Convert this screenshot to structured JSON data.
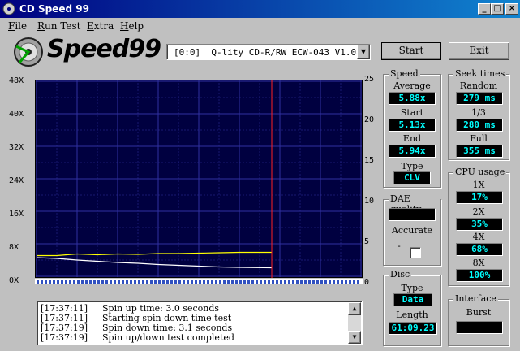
{
  "window": {
    "title": "CD Speed 99",
    "minimize": "_",
    "maximize": "□",
    "close": "×"
  },
  "menu": [
    "File",
    "Run Test",
    "Extra",
    "Help"
  ],
  "logo": {
    "text": "Speed99"
  },
  "drive": {
    "selected": "[0:0]  Q-lity CD-R/RW ECW-043 V1.0a",
    "arrow": "▼"
  },
  "buttons": {
    "start": "Start",
    "exit": "Exit"
  },
  "speed": {
    "title": "Speed",
    "average_label": "Average",
    "average": "5.88x",
    "start_label": "Start",
    "start": "5.13x",
    "end_label": "End",
    "end": "5.94x",
    "type_label": "Type",
    "type": "CLV"
  },
  "seek": {
    "title": "Seek times",
    "random_label": "Random",
    "random": "279 ms",
    "third_label": "1/3",
    "third": "280 ms",
    "full_label": "Full",
    "full": "355 ms"
  },
  "dae": {
    "title": "DAE quality",
    "value": "",
    "accurate_label": "Accurate",
    "accurate_dash": "-"
  },
  "cpu": {
    "title": "CPU usage",
    "items": [
      {
        "label": "1X",
        "value": "17%"
      },
      {
        "label": "2X",
        "value": "35%"
      },
      {
        "label": "4X",
        "value": "68%"
      },
      {
        "label": "8X",
        "value": "100%"
      }
    ]
  },
  "disc": {
    "title": "Disc",
    "type_label": "Type",
    "type": "Data",
    "length_label": "Length",
    "length": "61:09.23"
  },
  "interface": {
    "title": "Interface",
    "burst_label": "Burst",
    "burst": ""
  },
  "log": [
    {
      "time": "[17:37:11]",
      "msg": "Spin up time: 3.0 seconds"
    },
    {
      "time": "[17:37:11]",
      "msg": "Starting spin down time test"
    },
    {
      "time": "[17:37:19]",
      "msg": "Spin down time: 3.1 seconds"
    },
    {
      "time": "[17:37:19]",
      "msg": "Spin up/down test completed"
    }
  ],
  "chart_data": {
    "type": "line",
    "left_axis_labels": [
      "48X",
      "40X",
      "32X",
      "24X",
      "16X",
      "8X",
      "0X"
    ],
    "right_axis_labels": [
      "25",
      "20",
      "15",
      "10",
      "5",
      "0"
    ],
    "ylim": [
      0,
      48
    ],
    "ylim_right": [
      0,
      25
    ],
    "xlim": [
      0,
      80
    ],
    "marker_x": 58,
    "series": [
      {
        "color": "#ffff00",
        "x": [
          0,
          5,
          10,
          15,
          20,
          25,
          30,
          35,
          40,
          45,
          50,
          58
        ],
        "y": [
          5.1,
          5.1,
          5.5,
          5.3,
          5.5,
          5.4,
          5.6,
          5.6,
          5.7,
          5.8,
          5.9,
          5.9
        ]
      },
      {
        "color": "#ffffff",
        "x": [
          0,
          5,
          10,
          15,
          20,
          25,
          30,
          35,
          40,
          45,
          50,
          58
        ],
        "y": [
          4.6,
          4.4,
          4.0,
          3.7,
          3.4,
          3.2,
          2.9,
          2.7,
          2.5,
          2.3,
          2.2,
          2.1
        ]
      }
    ],
    "grid": true,
    "colors": {
      "background": "#000040",
      "grid": "#3030a0",
      "marker": "#ff2020"
    }
  }
}
